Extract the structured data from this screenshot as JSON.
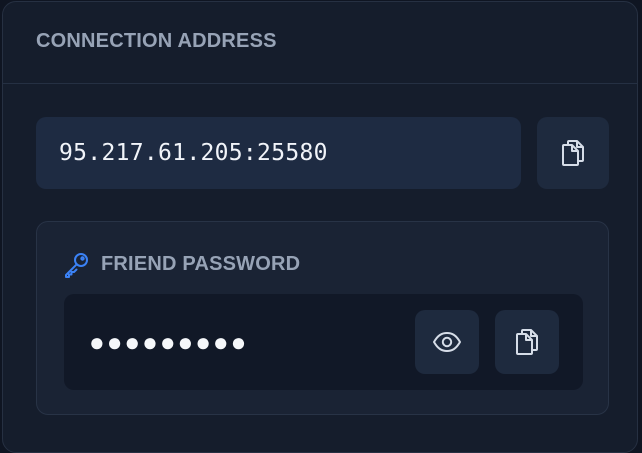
{
  "header": {
    "title": "CONNECTION ADDRESS"
  },
  "address": {
    "value": "95.217.61.205:25580",
    "copy_icon": "copy-icon"
  },
  "password_panel": {
    "key_icon": "key-icon",
    "title": "FRIEND PASSWORD",
    "masked_value": "●●●●●●●●●",
    "reveal_icon": "eye-icon",
    "copy_icon": "copy-icon"
  },
  "colors": {
    "background": "#151d2c",
    "field": "#1e2b42",
    "accent_key": "#3b82f6",
    "muted_text": "#97a3b6"
  }
}
